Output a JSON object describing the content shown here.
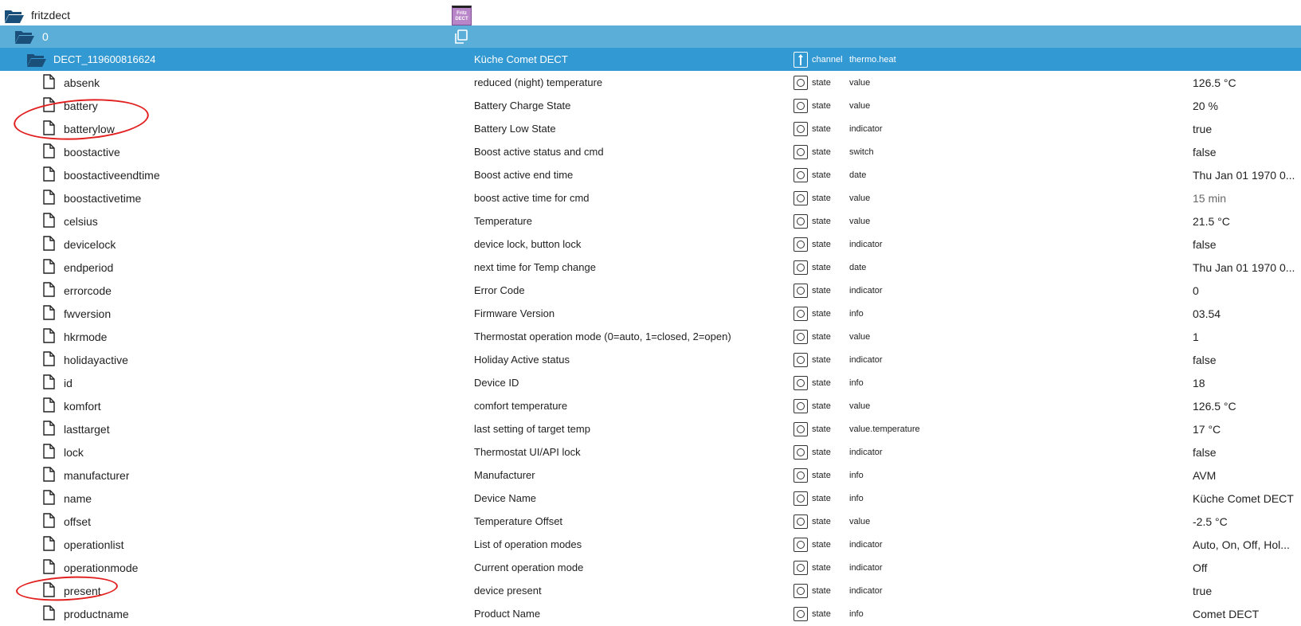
{
  "root": {
    "name": "fritzdect",
    "logo_line1": "Fritz",
    "logo_line2": "DECT"
  },
  "instance": {
    "name": "0"
  },
  "channel": {
    "id": "DECT_119600816624",
    "name": "Küche Comet DECT",
    "type": "channel",
    "role": "thermo.heat"
  },
  "states": [
    {
      "id": "absenk",
      "name": "reduced (night) temperature",
      "type": "state",
      "role": "value",
      "value": "126.5 °C"
    },
    {
      "id": "battery",
      "name": "Battery Charge State",
      "type": "state",
      "role": "value",
      "value": "20 %"
    },
    {
      "id": "batterylow",
      "name": "Battery Low State",
      "type": "state",
      "role": "indicator",
      "value": "true"
    },
    {
      "id": "boostactive",
      "name": "Boost active status and cmd",
      "type": "state",
      "role": "switch",
      "value": "false"
    },
    {
      "id": "boostactiveendtime",
      "name": "Boost active end time",
      "type": "state",
      "role": "date",
      "value": "Thu Jan 01 1970 0..."
    },
    {
      "id": "boostactivetime",
      "name": "boost active time for cmd",
      "type": "state",
      "role": "value",
      "value": "15 min",
      "muted": true
    },
    {
      "id": "celsius",
      "name": "Temperature",
      "type": "state",
      "role": "value",
      "value": "21.5 °C"
    },
    {
      "id": "devicelock",
      "name": "device lock, button lock",
      "type": "state",
      "role": "indicator",
      "value": "false"
    },
    {
      "id": "endperiod",
      "name": "next time for Temp change",
      "type": "state",
      "role": "date",
      "value": "Thu Jan 01 1970 0..."
    },
    {
      "id": "errorcode",
      "name": "Error Code",
      "type": "state",
      "role": "indicator",
      "value": "0"
    },
    {
      "id": "fwversion",
      "name": "Firmware Version",
      "type": "state",
      "role": "info",
      "value": "03.54"
    },
    {
      "id": "hkrmode",
      "name": "Thermostat operation mode (0=auto, 1=closed, 2=open)",
      "type": "state",
      "role": "value",
      "value": "1"
    },
    {
      "id": "holidayactive",
      "name": "Holiday Active status",
      "type": "state",
      "role": "indicator",
      "value": "false"
    },
    {
      "id": "id",
      "name": "Device ID",
      "type": "state",
      "role": "info",
      "value": "18"
    },
    {
      "id": "komfort",
      "name": "comfort temperature",
      "type": "state",
      "role": "value",
      "value": "126.5 °C"
    },
    {
      "id": "lasttarget",
      "name": "last setting of target temp",
      "type": "state",
      "role": "value.temperature",
      "value": "17 °C"
    },
    {
      "id": "lock",
      "name": "Thermostat UI/API lock",
      "type": "state",
      "role": "indicator",
      "value": "false"
    },
    {
      "id": "manufacturer",
      "name": "Manufacturer",
      "type": "state",
      "role": "info",
      "value": "AVM"
    },
    {
      "id": "name",
      "name": "Device Name",
      "type": "state",
      "role": "info",
      "value": "Küche Comet DECT"
    },
    {
      "id": "offset",
      "name": "Temperature Offset",
      "type": "state",
      "role": "value",
      "value": "-2.5 °C"
    },
    {
      "id": "operationlist",
      "name": "List of operation modes",
      "type": "state",
      "role": "indicator",
      "value": "Auto, On, Off, Hol..."
    },
    {
      "id": "operationmode",
      "name": "Current operation mode",
      "type": "state",
      "role": "indicator",
      "value": "Off"
    },
    {
      "id": "present",
      "name": "device present",
      "type": "state",
      "role": "indicator",
      "value": "true"
    },
    {
      "id": "productname",
      "name": "Product Name",
      "type": "state",
      "role": "info",
      "value": "Comet DECT"
    }
  ],
  "colors": {
    "instance_row": "#5aaed8",
    "channel_row": "#3399d3",
    "folder_icon": "#1a4f7a",
    "annotation": "#e21f1f"
  },
  "icons": {
    "folder": "folder-open-icon",
    "file": "file-icon",
    "state": "state-icon",
    "channel": "channel-icon",
    "copy": "copy-icon"
  }
}
